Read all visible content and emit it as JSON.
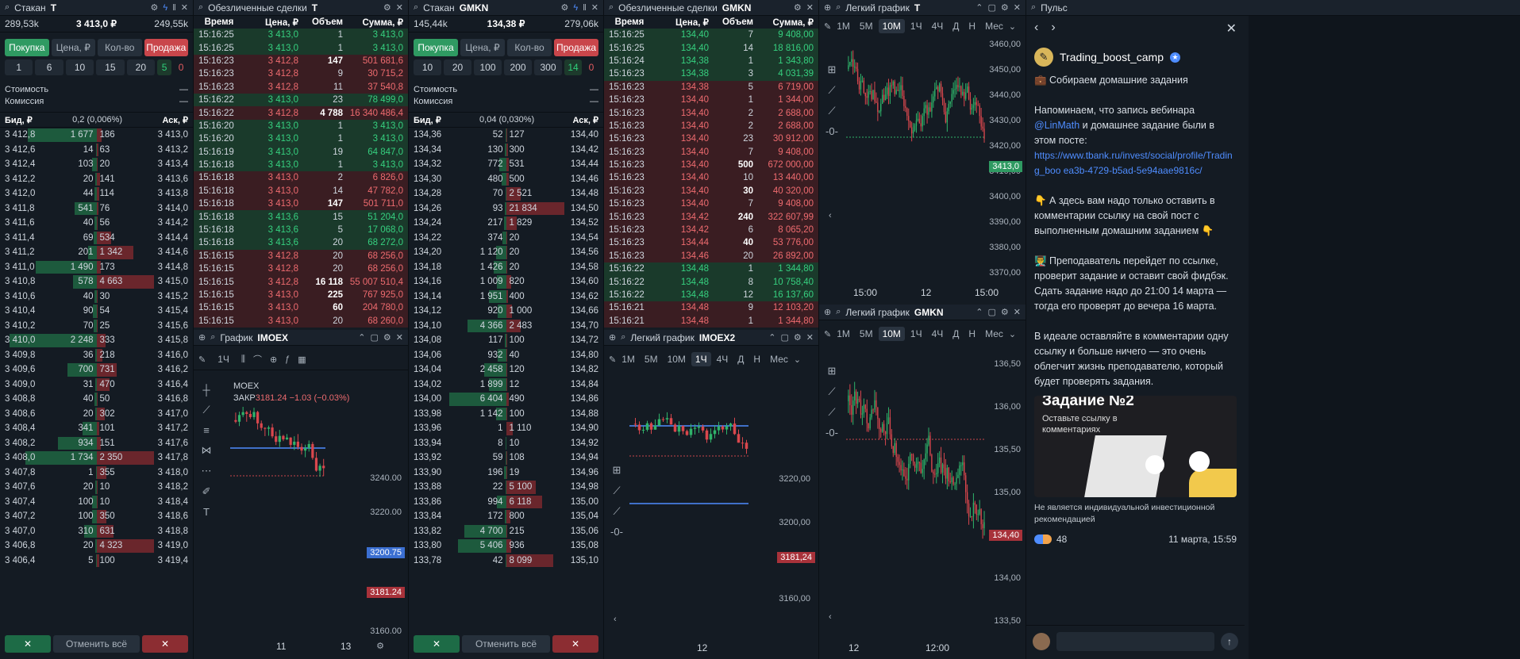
{
  "ob1": {
    "title": "Стакан",
    "ticker": "T",
    "vol1": "289,53k",
    "price": "3 413,0 ₽",
    "vol2": "249,55k",
    "buy": "Покупка",
    "price_lbl": "Цена, ₽",
    "qty_lbl": "Кол-во",
    "sell": "Продажа",
    "quick": [
      "1",
      "6",
      "10",
      "15",
      "20"
    ],
    "quick_g": "5",
    "quick_r": "0",
    "cost": "Стоимость",
    "fee": "Комиссия",
    "dash": "—",
    "bid": "Бид, ₽",
    "spread": "0,2 (0,006%)",
    "ask": "Аск, ₽",
    "rows": [
      [
        "3 412,8",
        "1 677",
        "186",
        "3 413,0"
      ],
      [
        "3 412,6",
        "14",
        "63",
        "3 413,2"
      ],
      [
        "3 412,4",
        "103",
        "20",
        "3 413,4"
      ],
      [
        "3 412,2",
        "20",
        "141",
        "3 413,6"
      ],
      [
        "3 412,0",
        "44",
        "114",
        "3 413,8"
      ],
      [
        "3 411,8",
        "541",
        "76",
        "3 414,0"
      ],
      [
        "3 411,6",
        "40",
        "56",
        "3 414,2"
      ],
      [
        "3 411,4",
        "69",
        "534",
        "3 414,4"
      ],
      [
        "3 411,2",
        "201",
        "1 342",
        "3 414,6"
      ],
      [
        "3 411,0",
        "1 490",
        "173",
        "3 414,8"
      ],
      [
        "3 410,8",
        "578",
        "4 663",
        "3 415,0"
      ],
      [
        "3 410,6",
        "40",
        "30",
        "3 415,2"
      ],
      [
        "3 410,4",
        "90",
        "54",
        "3 415,4"
      ],
      [
        "3 410,2",
        "70",
        "25",
        "3 415,6"
      ],
      [
        "3 410,0",
        "2 248",
        "333",
        "3 415,8"
      ],
      [
        "3 409,8",
        "36",
        "218",
        "3 416,0"
      ],
      [
        "3 409,6",
        "700",
        "731",
        "3 416,2"
      ],
      [
        "3 409,0",
        "31",
        "470",
        "3 416,4"
      ],
      [
        "3 408,8",
        "40",
        "50",
        "3 416,8"
      ],
      [
        "3 408,6",
        "20",
        "302",
        "3 417,0"
      ],
      [
        "3 408,4",
        "341",
        "101",
        "3 417,2"
      ],
      [
        "3 408,2",
        "934",
        "151",
        "3 417,6"
      ],
      [
        "3 408,0",
        "1 734",
        "2 350",
        "3 417,8"
      ],
      [
        "3 407,8",
        "1",
        "355",
        "3 418,0"
      ],
      [
        "3 407,6",
        "20",
        "10",
        "3 418,2"
      ],
      [
        "3 407,4",
        "100",
        "10",
        "3 418,4"
      ],
      [
        "3 407,2",
        "100",
        "350",
        "3 418,6"
      ],
      [
        "3 407,0",
        "310",
        "631",
        "3 418,8"
      ],
      [
        "3 406,8",
        "20",
        "4 323",
        "3 419,0"
      ],
      [
        "3 406,4",
        "5",
        "100",
        "3 419,4"
      ]
    ],
    "cancel": "Отменить всё",
    "x": "✕"
  },
  "tr1": {
    "title": "Обезличенные сделки",
    "ticker": "T",
    "h": [
      "Время",
      "Цена, ₽",
      "Объем",
      "Сумма, ₽"
    ],
    "rows": [
      [
        "g",
        "15:16:25",
        "3 413,0",
        "1",
        "3 413,0"
      ],
      [
        "g",
        "15:16:25",
        "3 413,0",
        "1",
        "3 413,0"
      ],
      [
        "r",
        "15:16:23",
        "3 412,8",
        "147",
        "501 681,6"
      ],
      [
        "r",
        "15:16:23",
        "3 412,8",
        "9",
        "30 715,2"
      ],
      [
        "r",
        "15:16:23",
        "3 412,8",
        "11",
        "37 540,8"
      ],
      [
        "g",
        "15:16:22",
        "3 413,0",
        "23",
        "78 499,0"
      ],
      [
        "r",
        "15:16:22",
        "3 412,8",
        "4 788",
        "16 340 486,4"
      ],
      [
        "g",
        "15:16:20",
        "3 413,0",
        "1",
        "3 413,0"
      ],
      [
        "g",
        "15:16:20",
        "3 413,0",
        "1",
        "3 413,0"
      ],
      [
        "g",
        "15:16:19",
        "3 413,0",
        "19",
        "64 847,0"
      ],
      [
        "g",
        "15:16:18",
        "3 413,0",
        "1",
        "3 413,0"
      ],
      [
        "r",
        "15:16:18",
        "3 413,0",
        "2",
        "6 826,0"
      ],
      [
        "r",
        "15:16:18",
        "3 413,0",
        "14",
        "47 782,0"
      ],
      [
        "r",
        "15:16:18",
        "3 413,0",
        "147",
        "501 711,0"
      ],
      [
        "g",
        "15:16:18",
        "3 413,6",
        "15",
        "51 204,0"
      ],
      [
        "g",
        "15:16:18",
        "3 413,6",
        "5",
        "17 068,0"
      ],
      [
        "g",
        "15:16:18",
        "3 413,6",
        "20",
        "68 272,0"
      ],
      [
        "r",
        "15:16:15",
        "3 412,8",
        "20",
        "68 256,0"
      ],
      [
        "r",
        "15:16:15",
        "3 412,8",
        "20",
        "68 256,0"
      ],
      [
        "r",
        "15:16:15",
        "3 412,8",
        "16 118",
        "55 007 510,4"
      ],
      [
        "r",
        "15:16:15",
        "3 413,0",
        "225",
        "767 925,0"
      ],
      [
        "r",
        "15:16:15",
        "3 413,0",
        "60",
        "204 780,0"
      ],
      [
        "r",
        "15:16:15",
        "3 413,0",
        "20",
        "68 260,0"
      ]
    ]
  },
  "ch1": {
    "title": "График",
    "ticker": "IMOEX",
    "tf": "1Ч",
    "sym": "MOEX",
    "close": "ЗАКР",
    "cv": "3181.24",
    "chg": "−1.03 (−0.03%)",
    "y": [
      "3240.00",
      "3220.00",
      "3160.00"
    ],
    "p_blue": "3200.75",
    "p_red": "3181.24",
    "x": [
      "11",
      "13"
    ]
  },
  "ob2": {
    "title": "Стакан",
    "ticker": "GMKN",
    "vol1": "145,44k",
    "price": "134,38 ₽",
    "vol2": "279,06k",
    "buy": "Покупка",
    "price_lbl": "Цена, ₽",
    "qty_lbl": "Кол-во",
    "sell": "Продажа",
    "quick": [
      "10",
      "20",
      "100",
      "200",
      "300"
    ],
    "quick_g": "14",
    "quick_r": "0",
    "cost": "Стоимость",
    "fee": "Комиссия",
    "dash": "—",
    "bid": "Бид, ₽",
    "spread": "0,04 (0,030%)",
    "ask": "Аск, ₽",
    "rows": [
      [
        "134,36",
        "52",
        "127",
        "134,40"
      ],
      [
        "134,34",
        "130",
        "300",
        "134,42"
      ],
      [
        "134,32",
        "772",
        "531",
        "134,44"
      ],
      [
        "134,30",
        "480",
        "500",
        "134,46"
      ],
      [
        "134,28",
        "70",
        "2 521",
        "134,48"
      ],
      [
        "134,26",
        "93",
        "21 834",
        "134,50"
      ],
      [
        "134,24",
        "217",
        "1 829",
        "134,52"
      ],
      [
        "134,22",
        "374",
        "20",
        "134,54"
      ],
      [
        "134,20",
        "1 120",
        "20",
        "134,56"
      ],
      [
        "134,18",
        "1 426",
        "20",
        "134,58"
      ],
      [
        "134,16",
        "1 009",
        "820",
        "134,60"
      ],
      [
        "134,14",
        "1 951",
        "400",
        "134,62"
      ],
      [
        "134,12",
        "920",
        "1 000",
        "134,66"
      ],
      [
        "134,10",
        "4 366",
        "2 483",
        "134,70"
      ],
      [
        "134,08",
        "117",
        "100",
        "134,72"
      ],
      [
        "134,06",
        "932",
        "40",
        "134,80"
      ],
      [
        "134,04",
        "2 458",
        "120",
        "134,82"
      ],
      [
        "134,02",
        "1 899",
        "12",
        "134,84"
      ],
      [
        "134,00",
        "6 404",
        "490",
        "134,86"
      ],
      [
        "133,98",
        "1 142",
        "100",
        "134,88"
      ],
      [
        "133,96",
        "1",
        "1 110",
        "134,90"
      ],
      [
        "133,94",
        "8",
        "10",
        "134,92"
      ],
      [
        "133,92",
        "59",
        "108",
        "134,94"
      ],
      [
        "133,90",
        "196",
        "19",
        "134,96"
      ],
      [
        "133,88",
        "22",
        "5 100",
        "134,98"
      ],
      [
        "133,86",
        "994",
        "6 118",
        "135,00"
      ],
      [
        "133,84",
        "172",
        "800",
        "135,04"
      ],
      [
        "133,82",
        "4 700",
        "215",
        "135,06"
      ],
      [
        "133,80",
        "5 406",
        "936",
        "135,08"
      ],
      [
        "133,78",
        "42",
        "8 099",
        "135,10"
      ]
    ],
    "cancel": "Отменить всё",
    "x": "✕"
  },
  "tr2": {
    "title": "Обезличенные сделки",
    "ticker": "GMKN",
    "h": [
      "Время",
      "Цена, ₽",
      "Объем",
      "Сумма, ₽"
    ],
    "rows": [
      [
        "g",
        "15:16:25",
        "134,40",
        "7",
        "9 408,00"
      ],
      [
        "g",
        "15:16:25",
        "134,40",
        "14",
        "18 816,00"
      ],
      [
        "g",
        "15:16:24",
        "134,38",
        "1",
        "1 343,80"
      ],
      [
        "g",
        "15:16:23",
        "134,38",
        "3",
        "4 031,39"
      ],
      [
        "r",
        "15:16:23",
        "134,38",
        "5",
        "6 719,00"
      ],
      [
        "r",
        "15:16:23",
        "134,40",
        "1",
        "1 344,00"
      ],
      [
        "r",
        "15:16:23",
        "134,40",
        "2",
        "2 688,00"
      ],
      [
        "r",
        "15:16:23",
        "134,40",
        "2",
        "2 688,00"
      ],
      [
        "r",
        "15:16:23",
        "134,40",
        "23",
        "30 912,00"
      ],
      [
        "r",
        "15:16:23",
        "134,40",
        "7",
        "9 408,00"
      ],
      [
        "r",
        "15:16:23",
        "134,40",
        "500",
        "672 000,00"
      ],
      [
        "r",
        "15:16:23",
        "134,40",
        "10",
        "13 440,00"
      ],
      [
        "r",
        "15:16:23",
        "134,40",
        "30",
        "40 320,00"
      ],
      [
        "r",
        "15:16:23",
        "134,40",
        "7",
        "9 408,00"
      ],
      [
        "r",
        "15:16:23",
        "134,42",
        "240",
        "322 607,99"
      ],
      [
        "r",
        "15:16:23",
        "134,42",
        "6",
        "8 065,20"
      ],
      [
        "r",
        "15:16:23",
        "134,44",
        "40",
        "53 776,00"
      ],
      [
        "r",
        "15:16:23",
        "134,46",
        "20",
        "26 892,00"
      ],
      [
        "g",
        "15:16:22",
        "134,48",
        "1",
        "1 344,80"
      ],
      [
        "g",
        "15:16:22",
        "134,48",
        "8",
        "10 758,40"
      ],
      [
        "g",
        "15:16:22",
        "134,48",
        "12",
        "16 137,60"
      ],
      [
        "r",
        "15:16:21",
        "134,48",
        "9",
        "12 103,20"
      ],
      [
        "r",
        "15:16:21",
        "134,48",
        "1",
        "1 344,80"
      ]
    ]
  },
  "ch2": {
    "title": "Легкий график",
    "ticker": "IMOEX2",
    "tfs": [
      "1М",
      "5М",
      "10М",
      "1Ч",
      "4Ч",
      "Д",
      "Н",
      "Мес"
    ],
    "active": "1Ч",
    "y": [
      "3220,00",
      "3200,00",
      "3160,00"
    ],
    "p_red": "3181,24",
    "x": [
      "12"
    ]
  },
  "ch3": {
    "title": "Легкий график",
    "ticker": "T",
    "tfs": [
      "1М",
      "5М",
      "10М",
      "1Ч",
      "4Ч",
      "Д",
      "Н",
      "Мес"
    ],
    "active": "10М",
    "y": [
      "3460,00",
      "3450,00",
      "3440,00",
      "3430,00",
      "3420,00",
      "3410,00",
      "3400,00",
      "3390,00",
      "3380,00",
      "3370,00"
    ],
    "p_green": "3413,0",
    "x": [
      "15:00",
      "12",
      "15:00"
    ]
  },
  "ch4": {
    "title": "Легкий график",
    "ticker": "GMKN",
    "tfs": [
      "1М",
      "5М",
      "10М",
      "1Ч",
      "4Ч",
      "Д",
      "Н",
      "Мес"
    ],
    "active": "10М",
    "y": [
      "136,50",
      "136,00",
      "135,50",
      "135,00",
      "134,50",
      "134,00",
      "133,50"
    ],
    "p_red": "134,40",
    "x": [
      "12",
      "12:00"
    ]
  },
  "pulse": {
    "title": "Пульс",
    "author": "Trading_boost_camp",
    "head": "💼 Собираем домашние задания",
    "p1a": "Напоминаем, что запись вебинара ",
    "mention": "@LinMath",
    "p1b": " и домашнее задание были в этом посте:",
    "link": "https://www.tbank.ru/invest/social/profile/Trading_boo ea3b-4729-b5ad-5e94aae9816c/",
    "p2": "👇 А здесь вам надо только оставить в комментарии ссылку на свой пост с выполненным домашним заданием 👇",
    "p3": "👨‍🏫 Преподаватель перейдет по ссылке, проверит задание и оставит свой фидбэк. Сдать задание надо до 21:00 14 марта — тогда его проверят до вечера 16 марта.",
    "p4": "В идеале оставляйте в комментарии одну ссылку и больше ничего — это очень облегчит жизнь преподавателю, который будет проверять задания.",
    "img_title": "Задание №2",
    "img_sub": "Оставьте ссылку в комментариях",
    "disclaimer": "Не является индивидуальной инвестиционной рекомендацией",
    "likes": "48",
    "date": "11 марта, 15:59"
  },
  "colors": {
    "green": "#2f9a62",
    "red": "#c9464b",
    "blue": "#4f8dff"
  }
}
